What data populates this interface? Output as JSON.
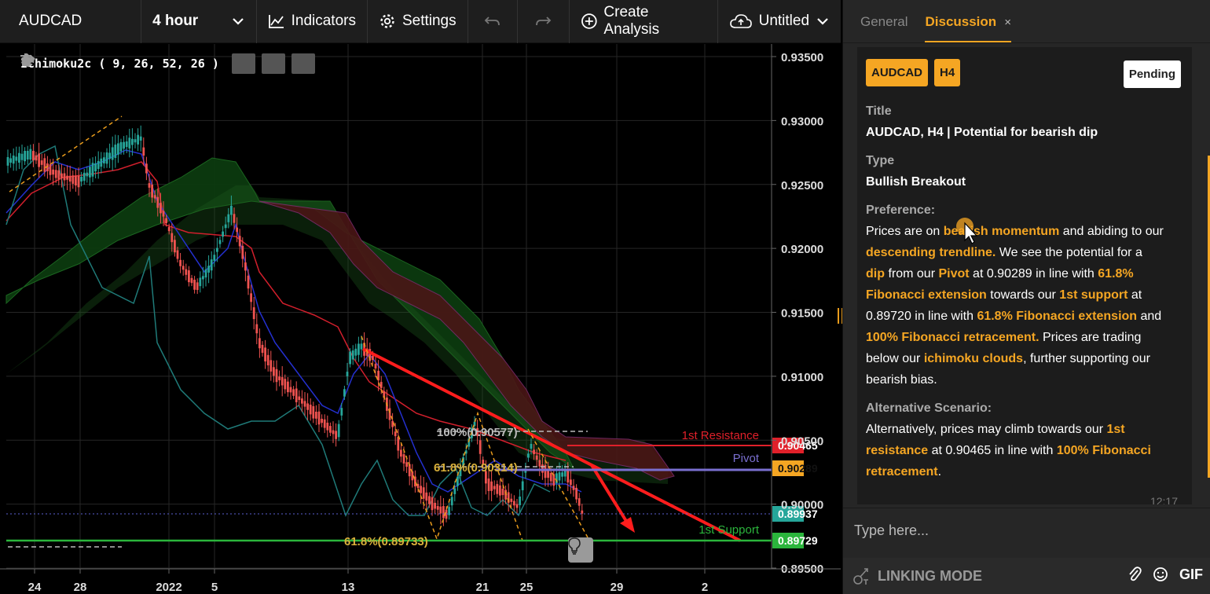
{
  "toolbar": {
    "symbol": "AUDCAD",
    "interval": "4 hour",
    "indicators_label": "Indicators",
    "settings_label": "Settings",
    "create_analysis_label": "Create Analysis",
    "save_label": "Untitled"
  },
  "indicator": {
    "label": "Ichimoku2c ( 9, 26, 52, 26 )"
  },
  "chart": {
    "price_ticks": [
      "0.93500",
      "0.93000",
      "0.92500",
      "0.92000",
      "0.91500",
      "0.91000",
      "0.90500",
      "0.90000",
      "0.89500"
    ],
    "time_ticks": [
      "24",
      "28",
      "2022",
      "5",
      "13",
      "21",
      "25",
      "29",
      "2"
    ],
    "levels": {
      "resistance": {
        "label": "1st Resistance",
        "value": "0.90465",
        "color": "#e0202a"
      },
      "pivot": {
        "label": "Pivot",
        "value": "0.90289",
        "color": "#f5a623"
      },
      "support": {
        "label": "1st Support",
        "value": "0.89729",
        "color": "#2bb53c"
      },
      "current": {
        "value": "0.89937",
        "color": "#26a69a"
      }
    },
    "fib_labels": {
      "f100": "100%(0.90577)",
      "f618a": "61.8%(0.90314)",
      "f618b": "61.8%(0.89733)"
    }
  },
  "panel": {
    "tabs": {
      "general": "General",
      "discussion": "Discussion",
      "close": "×"
    },
    "badges": {
      "symbol": "AUDCAD",
      "timeframe": "H4"
    },
    "status": "Pending",
    "title_label": "Title",
    "title_value": "AUDCAD, H4 | Potential for bearish dip",
    "type_label": "Type",
    "type_value": "Bullish Breakout",
    "preference_label": "Preference:",
    "preference": {
      "t1": "Prices are on ",
      "h1": "bearish momentum",
      "t2": " and abiding to our ",
      "h2": "descending trendline.",
      "t3": " We see the potential for a ",
      "h3": "dip",
      "t4": " from our ",
      "h4": "Pivot",
      "t5": " at 0.90289 in line with ",
      "h5": "61.8% Fibonacci extension",
      "t6": " towards our ",
      "h6": "1st support",
      "t7": " at 0.89720 in line with ",
      "h7": "61.8% Fibonacci extension",
      "t8": " and ",
      "h8": "100% Fibonacci retracement.",
      "t9": " Prices are trading below our ",
      "h9": "ichimoku clouds",
      "t10": ", further supporting our bearish bias."
    },
    "alternative_label": "Alternative Scenario:",
    "alternative": {
      "t1": "Alternatively, prices may climb towards our ",
      "h1": "1st resistance",
      "t2": " at 0.90465 in line with ",
      "h2": "100% Fibonacci retracement",
      "t3": "."
    },
    "timestamp": "12:17",
    "reply_placeholder": "Type here...",
    "linking_mode": "LINKING MODE",
    "gif_label": "GIF"
  }
}
